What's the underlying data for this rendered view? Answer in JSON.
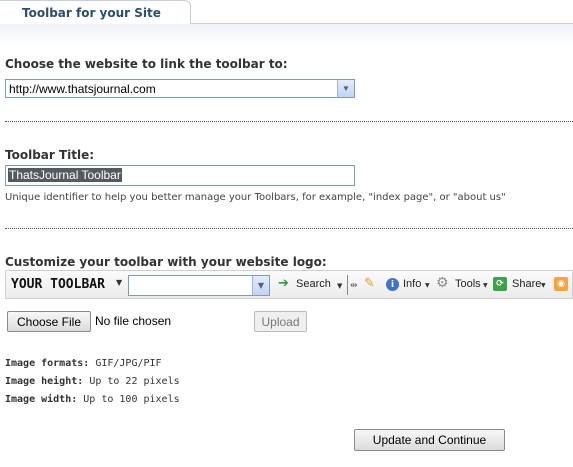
{
  "tab": {
    "title": "Toolbar for your Site"
  },
  "website": {
    "label": "Choose the website to link the toolbar to:",
    "selected": "http://www.thatsjournal.com"
  },
  "title_field": {
    "label": "Toolbar Title:",
    "value": "ThatsJournal Toolbar",
    "hint": "Unique identifier to help you better manage your Toolbars, for example, \"index page\", or \"about us\""
  },
  "logo": {
    "label": "Customize your toolbar with your website logo:"
  },
  "preview": {
    "logo_text": "YOUR TOOLBAR",
    "search_label": "Search",
    "info_label": "Info",
    "tools_label": "Tools",
    "share_label": "Share"
  },
  "file": {
    "choose_label": "Choose File",
    "status": "No file chosen",
    "upload_label": "Upload"
  },
  "requirements": {
    "formats_label": "Image formats:",
    "formats_value": "GIF/JPG/PIF",
    "height_label": "Image height:",
    "height_value": "Up to 22 pixels",
    "width_label": "Image width:",
    "width_value": "Up to 100 pixels"
  },
  "submit": {
    "label": "Update and Continue"
  }
}
